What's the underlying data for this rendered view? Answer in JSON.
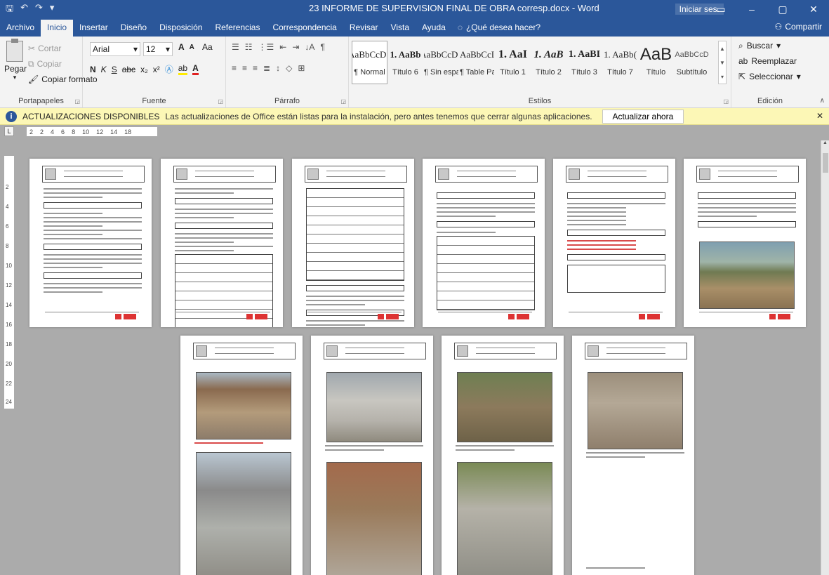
{
  "window": {
    "title": "23 INFORME DE SUPERVISION FINAL DE OBRA corresp.docx - Word",
    "signin": "Iniciar ses.",
    "controls": [
      "▭",
      "–",
      "▢",
      "✕"
    ]
  },
  "tabs": [
    "Archivo",
    "Inicio",
    "Insertar",
    "Diseño",
    "Disposición",
    "Referencias",
    "Correspondencia",
    "Revisar",
    "Vista",
    "Ayuda"
  ],
  "tellme": "¿Qué desea hacer?",
  "share": "Compartir",
  "ribbon": {
    "clipboard": {
      "paste": "Pegar",
      "cut": "Cortar",
      "copy": "Copiar",
      "format_painter": "Copiar formato",
      "label": "Portapapeles"
    },
    "font": {
      "name": "Arial",
      "size": "12",
      "grow": "A",
      "shrink": "A",
      "case": "Aa",
      "bold": "N",
      "italic": "K",
      "underline": "S",
      "strike": "abc",
      "subscript": "x₂",
      "superscript": "x²",
      "label": "Fuente"
    },
    "paragraph": {
      "label": "Párrafo"
    },
    "styles": {
      "items": [
        {
          "preview": "AaBbCcD¢",
          "name": "¶ Normal"
        },
        {
          "preview": "1. AaBb",
          "name": "Título 6"
        },
        {
          "preview": "AaBbCcD¢",
          "name": "¶ Sin espa..."
        },
        {
          "preview": "AaBbCcI",
          "name": "¶ Table Pa..."
        },
        {
          "preview": "1. AaI",
          "name": "Título 1"
        },
        {
          "preview": "1. AaB",
          "name": "Título 2"
        },
        {
          "preview": "1. AaBI",
          "name": "Título 3"
        },
        {
          "preview": "1. AaBb(",
          "name": "Título 7"
        },
        {
          "preview": "AaB",
          "name": "Título"
        },
        {
          "preview": "AaBbCcD",
          "name": "Subtítulo"
        }
      ],
      "label": "Estilos"
    },
    "editing": {
      "find": "Buscar",
      "replace": "Reemplazar",
      "select": "Seleccionar",
      "label": "Edición"
    }
  },
  "message": {
    "title": "ACTUALIZACIONES DISPONIBLES",
    "text": "Las actualizaciones de Office están listas para la instalación, pero antes tenemos que cerrar algunas aplicaciones.",
    "button": "Actualizar ahora"
  },
  "ruler": {
    "ticks": [
      "2",
      "2",
      "4",
      "6",
      "8",
      "10",
      "12",
      "14",
      "18"
    ],
    "vticks": [
      "2",
      "4",
      "6",
      "8",
      "10",
      "12",
      "14",
      "16",
      "18",
      "20",
      "22",
      "24"
    ]
  },
  "colors": {
    "brand": "#2b579a",
    "ribbon_bg": "#f3f3f3",
    "message_bg": "#fcf7b6",
    "workspace": "#ababab"
  }
}
